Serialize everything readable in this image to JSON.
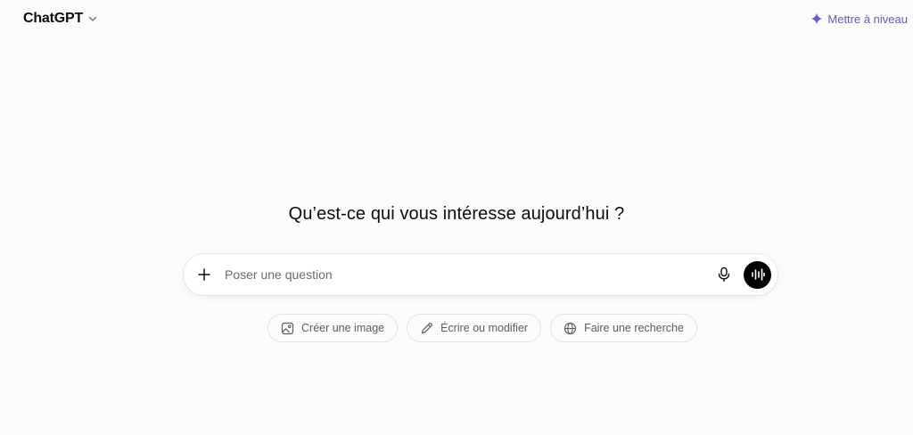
{
  "header": {
    "model_name": "ChatGPT",
    "upgrade_label": "Mettre à niveau",
    "accent_color": "#5d5bd4"
  },
  "main": {
    "headline": "Qu’est-ce qui vous intéresse aujourd’hui ?"
  },
  "composer": {
    "placeholder": "Poser une question",
    "value": ""
  },
  "suggestions": [
    {
      "label": "Créer une image",
      "icon": "image-icon"
    },
    {
      "label": "Écrire ou modifier",
      "icon": "pencil-icon"
    },
    {
      "label": "Faire une recherche",
      "icon": "globe-icon"
    }
  ]
}
